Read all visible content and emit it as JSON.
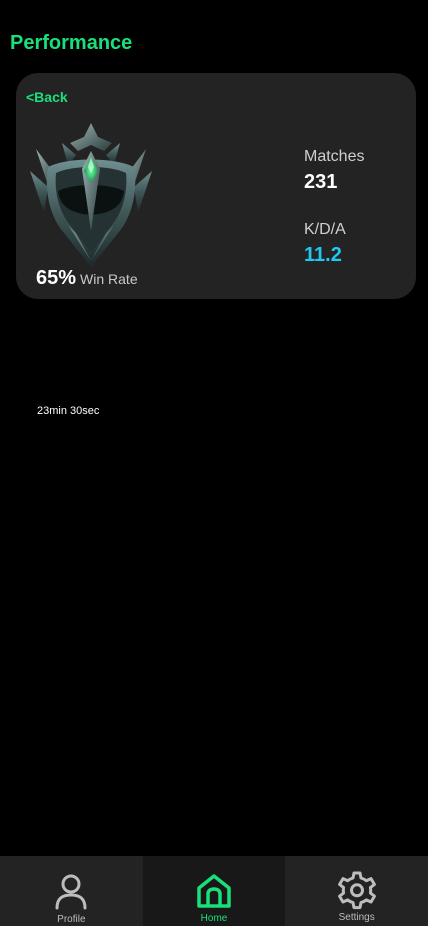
{
  "header": {
    "title": "Performance"
  },
  "card": {
    "back_label": "<Back",
    "win_rate": {
      "value": "65%",
      "label": "Win Rate"
    },
    "stats": {
      "matches_label": "Matches",
      "matches_value": "231",
      "kda_label": "K/D/A",
      "kda_value": "11.2"
    },
    "emblem_icon": "rank-emblem-icon"
  },
  "match_duration": "23min 30sec",
  "nav": {
    "active": "home",
    "items": [
      {
        "id": "profile",
        "label": "Profile",
        "icon": "user-icon"
      },
      {
        "id": "home",
        "label": "Home",
        "icon": "home-icon"
      },
      {
        "id": "settings",
        "label": "Settings",
        "icon": "gear-icon"
      }
    ]
  },
  "colors": {
    "accent": "#19e07a",
    "kda_value": "#1fc8ef",
    "card_bg": "#232323",
    "nav_bg": "#232323",
    "nav_active_bg": "#181818",
    "page_bg": "#000000"
  }
}
